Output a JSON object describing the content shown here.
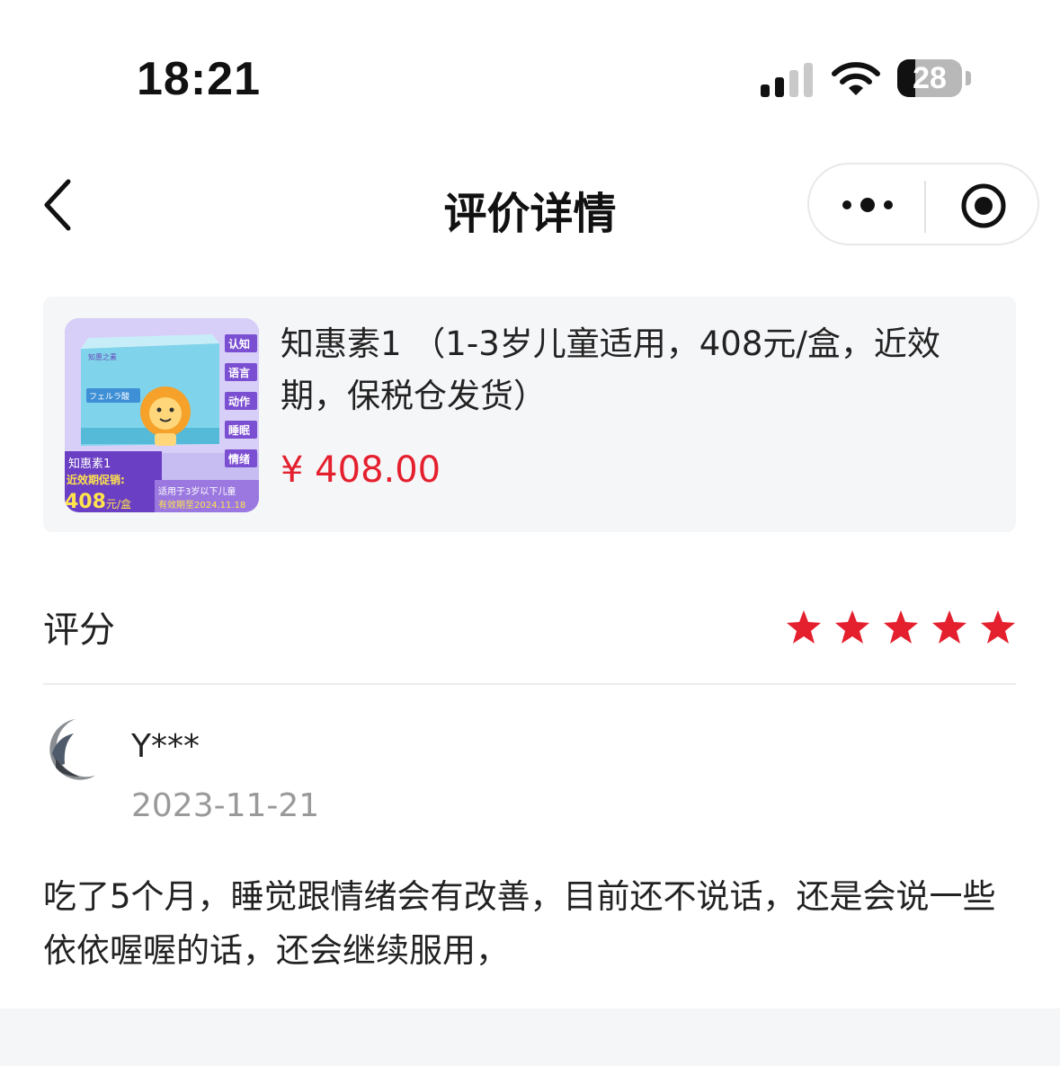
{
  "status_bar": {
    "time": "18:21",
    "battery_level": "28",
    "icons": [
      "cellular-signal-icon",
      "wifi-icon",
      "battery-icon"
    ]
  },
  "nav": {
    "back_icon": "chevron-left-icon",
    "title": "评价详情",
    "more_icon": "more-dots-icon",
    "close_icon": "target-circle-icon"
  },
  "product": {
    "name": "知惠素1 （1-3岁儿童适用，408元/盒，近效期，保税仓发货）",
    "price": "¥ 408.00",
    "image": {
      "side_tags": [
        "认知",
        "语言",
        "动作",
        "睡眠",
        "情绪"
      ],
      "box_brand": "知惠之素",
      "box_label": "フェルラ酸",
      "promo_name": "知惠素1",
      "promo_text": "近效期促销:",
      "promo_price": "408",
      "promo_unit": "元/盒",
      "footer_line1": "适用于3岁以下儿童",
      "footer_line2": "有效期至2024.11.18"
    }
  },
  "rating": {
    "label": "评分",
    "stars": 5,
    "max_stars": 5,
    "color": "#e4202f"
  },
  "review": {
    "username": "Y***",
    "date": "2023-11-21",
    "text": "吃了5个月，睡觉跟情绪会有改善，目前还不说话，还是会说一些依依喔喔的话，还会继续服用，"
  },
  "colors": {
    "accent": "#e4202f",
    "card_bg": "#f5f6f8",
    "muted_text": "#999999"
  }
}
